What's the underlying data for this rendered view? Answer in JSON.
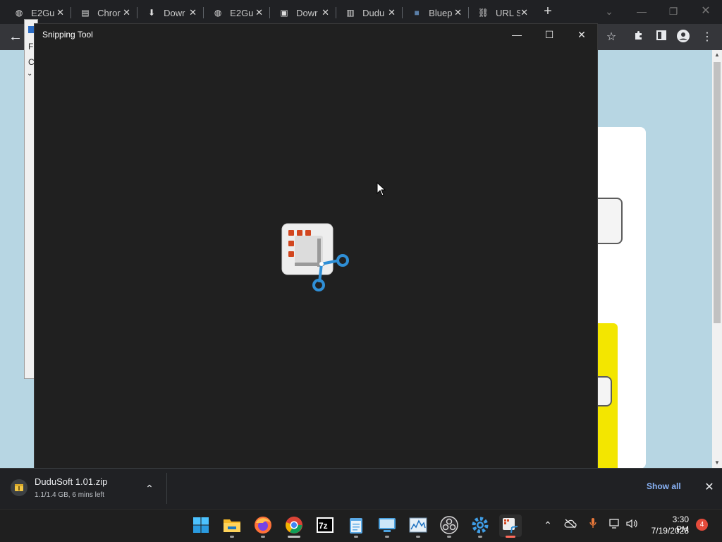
{
  "browser": {
    "tabs": [
      {
        "label": "E2Gu",
        "icon": "globe-icon"
      },
      {
        "label": "Chror",
        "icon": "chrome-store-icon"
      },
      {
        "label": "Dowr",
        "icon": "download-icon"
      },
      {
        "label": "E2Gu",
        "icon": "globe-icon"
      },
      {
        "label": "Dowr",
        "icon": "app-window-icon"
      },
      {
        "label": "Dudu",
        "icon": "building-icon"
      },
      {
        "label": "Bluep",
        "icon": "folder-icon"
      },
      {
        "label": "URL S",
        "icon": "link-icon"
      }
    ],
    "tab_close": "✕",
    "new_tab": "+"
  },
  "background_window": {
    "menu_f": "F",
    "menu_c": "C",
    "chevron": "⌄"
  },
  "snipping_tool": {
    "title": "Snipping Tool",
    "minimize": "—",
    "maximize": "☐",
    "close": "✕"
  },
  "download_bar": {
    "file_name": "DuduSoft 1.01.zip",
    "status": "1.1/1.4 GB, 6 mins left",
    "show_all": "Show all",
    "close": "✕",
    "chevron": "⌃"
  },
  "taskbar": {
    "apps": [
      "windows-start-icon",
      "file-explorer-icon",
      "firefox-icon",
      "chrome-icon",
      "7zip-icon",
      "notepad-icon",
      "remote-desktop-icon",
      "resource-monitor-icon",
      "obs-icon",
      "settings-gear-icon",
      "snipping-tool-icon"
    ],
    "time": "3:30 PM",
    "date": "7/19/2023",
    "notification_count": "4"
  },
  "colors": {
    "snip_bg": "#202020",
    "page_bg": "#b7d6e3",
    "accent_yellow": "#f3e600",
    "link_blue": "#8ab4f8"
  }
}
